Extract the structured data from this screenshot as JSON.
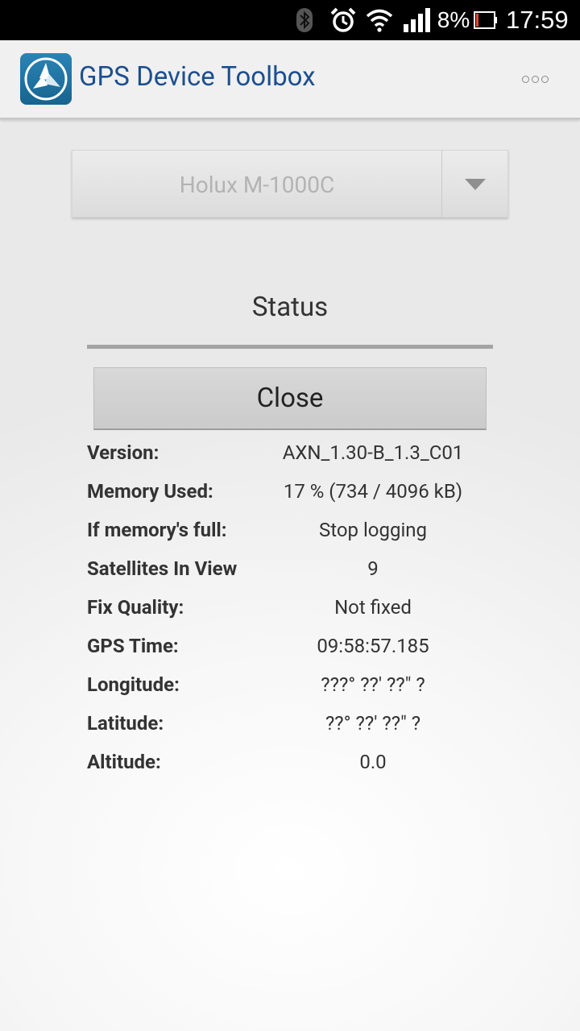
{
  "status_bar": {
    "battery_percent": "8%",
    "time": "17:59",
    "icons": [
      "bluetooth-icon",
      "alarm-icon",
      "wifi-icon",
      "signal-icon",
      "battery-icon"
    ]
  },
  "action_bar": {
    "title": "GPS Device Toolbox",
    "app_icon": "app-logo-icon",
    "overflow_icon": "overflow-menu-icon"
  },
  "device_spinner": {
    "selected": "Holux M-1000C"
  },
  "dialog": {
    "title": "Status",
    "close_label": "Close",
    "rows": [
      {
        "label": "Version:",
        "value": "AXN_1.30-B_1.3_C01"
      },
      {
        "label": "Memory Used:",
        "value": "17 % (734 / 4096 kB)"
      },
      {
        "label": "If memory's full:",
        "value": "Stop logging"
      },
      {
        "label": "Satellites In View",
        "value": "9"
      },
      {
        "label": "Fix Quality:",
        "value": "Not fixed"
      },
      {
        "label": "GPS Time:",
        "value": "09:58:57.185"
      },
      {
        "label": "Longitude:",
        "value": "???° ??' ??\" ?"
      },
      {
        "label": "Latitude:",
        "value": "??° ??' ??\" ?"
      },
      {
        "label": "Altitude:",
        "value": "0.0"
      }
    ]
  },
  "colors": {
    "title_blue": "#1c4f8f",
    "icon_blue": "#1f75a6"
  }
}
